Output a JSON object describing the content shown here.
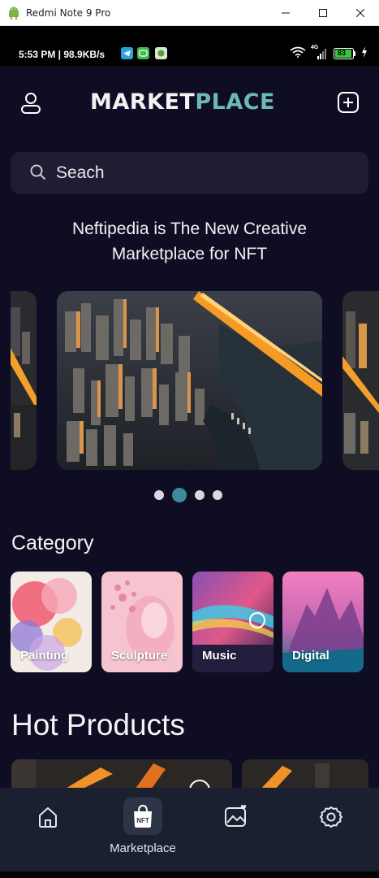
{
  "window": {
    "title": "Redmi Note 9 Pro"
  },
  "statusbar": {
    "time_speed": "5:53 PM | 98.9KB/s",
    "network": "4G",
    "battery": "83"
  },
  "header": {
    "logo_part1": "MARKET",
    "logo_part2": "PLACE"
  },
  "search": {
    "placeholder": "Seach"
  },
  "hero": {
    "line1": "Neftipedia is The New Creative",
    "line2": "Marketplace for NFT"
  },
  "carousel": {
    "slide_count": 4,
    "active_index": 1
  },
  "category": {
    "title": "Category",
    "items": [
      {
        "label": "Painting"
      },
      {
        "label": "Sculpture"
      },
      {
        "label": "Music"
      },
      {
        "label": "Digital"
      }
    ]
  },
  "hot_products": {
    "title": "Hot Products"
  },
  "bottom_nav": {
    "items": [
      {
        "icon": "home-icon"
      },
      {
        "icon": "nft-bag-icon",
        "label": "Marketplace",
        "active": true
      },
      {
        "icon": "gallery-favorite-icon"
      },
      {
        "icon": "settings-icon"
      }
    ],
    "nft_badge": "NFT"
  },
  "colors": {
    "background": "#0f0d23",
    "accent": "#6db8bb",
    "active_dot": "#3d8a98",
    "search_bg": "#1f1d33",
    "nav_bg": "#1a2030"
  }
}
